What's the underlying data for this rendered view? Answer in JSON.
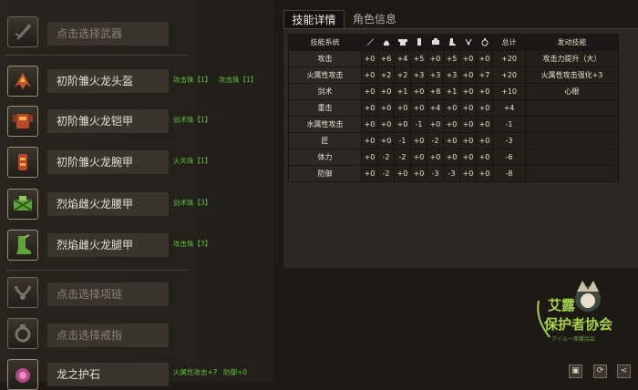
{
  "equipment": [
    {
      "name": "点击选择武器",
      "empty": true,
      "decorations": []
    },
    {
      "name": "初阶雏火龙头盔",
      "empty": false,
      "decorations": [
        "攻击珠【1】",
        "攻击珠【1】"
      ]
    },
    {
      "name": "初阶雏火龙铠甲",
      "empty": false,
      "decorations": [
        "剑术珠【1】"
      ]
    },
    {
      "name": "初阶雏火龙腕甲",
      "empty": false,
      "decorations": [
        "火炎珠【1】"
      ]
    },
    {
      "name": "烈焰雌火龙腰甲",
      "empty": false,
      "decorations": [
        "剑术珠【3】"
      ]
    },
    {
      "name": "烈焰雌火龙腿甲",
      "empty": false,
      "decorations": [
        "攻击珠【3】"
      ]
    },
    {
      "name": "点击选择项链",
      "empty": true,
      "decorations": []
    },
    {
      "name": "点击选择戒指",
      "empty": true,
      "decorations": []
    },
    {
      "name": "龙之护石",
      "empty": false,
      "decorations": [
        "火属性攻击+7",
        "防御+0"
      ]
    }
  ],
  "tabs": [
    {
      "label": "技能详情",
      "active": true
    },
    {
      "label": "角色信息",
      "active": false
    }
  ],
  "table": {
    "header_skill": "技能系统",
    "header_total": "总计",
    "header_activated": "发动技能",
    "column_icons": [
      "weapon-icon",
      "helmet-icon",
      "chest-icon",
      "arm-icon",
      "waist-icon",
      "leg-icon",
      "necklace-icon",
      "ring-icon"
    ],
    "rows": [
      {
        "skill": "攻击",
        "values": [
          "+0",
          "+6",
          "+4",
          "+5",
          "+0",
          "+5",
          "+0",
          "+0"
        ],
        "total": "+20",
        "activated": "攻击力提升（大）"
      },
      {
        "skill": "火属性攻击",
        "values": [
          "+0",
          "+2",
          "+2",
          "+3",
          "+3",
          "+3",
          "+0",
          "+7"
        ],
        "total": "+20",
        "activated": "火属性攻击强化+3"
      },
      {
        "skill": "剑术",
        "values": [
          "+0",
          "+0",
          "+1",
          "+0",
          "+8",
          "+1",
          "+0",
          "+0"
        ],
        "total": "+10",
        "activated": "心眼"
      },
      {
        "skill": "重击",
        "values": [
          "+0",
          "+0",
          "+0",
          "+0",
          "+4",
          "+0",
          "+0",
          "+0"
        ],
        "total": "+4",
        "activated": ""
      },
      {
        "skill": "水属性攻击",
        "values": [
          "+0",
          "+0",
          "+0",
          "-1",
          "+0",
          "+0",
          "+0",
          "+0"
        ],
        "total": "-1",
        "activated": ""
      },
      {
        "skill": "匠",
        "values": [
          "+0",
          "+0",
          "-1",
          "+0",
          "-2",
          "+0",
          "+0",
          "+0"
        ],
        "total": "-3",
        "activated": ""
      },
      {
        "skill": "体力",
        "values": [
          "+0",
          "-2",
          "-2",
          "+0",
          "+0",
          "+0",
          "+0",
          "+0"
        ],
        "total": "-6",
        "activated": ""
      },
      {
        "skill": "防御",
        "values": [
          "+0",
          "-2",
          "+0",
          "+0",
          "-3",
          "-3",
          "+0",
          "+0"
        ],
        "total": "-8",
        "activated": ""
      }
    ]
  },
  "logo": {
    "line1": "艾露",
    "line2": "保护者协会",
    "sub": "アイルー保護協会"
  },
  "colors": {
    "accent_green": "#5ec23c",
    "logo_green": "#a6d148"
  }
}
